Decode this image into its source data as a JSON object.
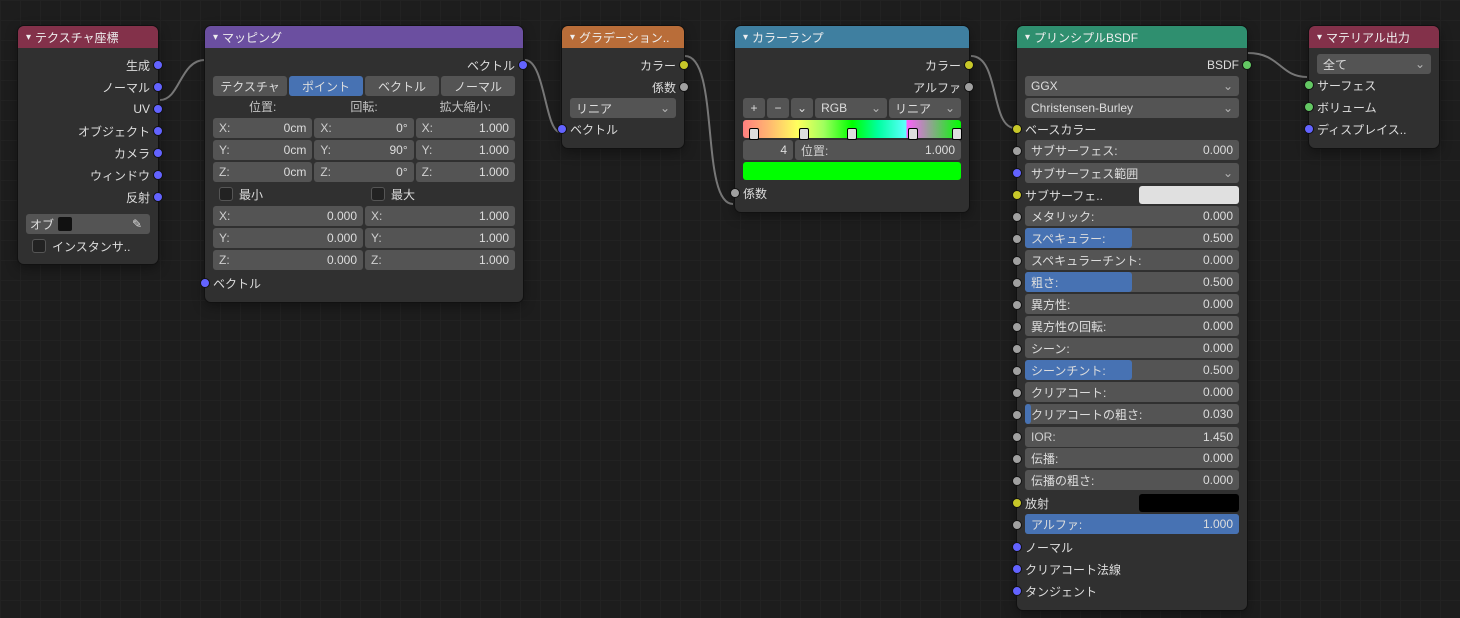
{
  "texcoord": {
    "title": "テクスチャ座標",
    "outs": [
      "生成",
      "ノーマル",
      "UV",
      "オブジェクト",
      "カメラ",
      "ウィンドウ",
      "反射"
    ],
    "obj_label": "オブ",
    "instancer": "インスタンサ.."
  },
  "mapping": {
    "title": "マッピング",
    "out": "ベクトル",
    "tabs": [
      "テクスチャ",
      "ポイント",
      "ベクトル",
      "ノーマル"
    ],
    "col_labels": [
      "位置:",
      "回転:",
      "拡大縮小:"
    ],
    "rows": [
      [
        "X:",
        "0cm",
        "X:",
        "0°",
        "X:",
        "1.000"
      ],
      [
        "Y:",
        "0cm",
        "Y:",
        "90°",
        "Y:",
        "1.000"
      ],
      [
        "Z:",
        "0cm",
        "Z:",
        "0°",
        "Z:",
        "1.000"
      ]
    ],
    "min": "最小",
    "max": "最大",
    "min_rows": [
      [
        "X:",
        "0.000"
      ],
      [
        "Y:",
        "0.000"
      ],
      [
        "Z:",
        "0.000"
      ]
    ],
    "max_rows": [
      [
        "X:",
        "1.000"
      ],
      [
        "Y:",
        "1.000"
      ],
      [
        "Z:",
        "1.000"
      ]
    ],
    "in": "ベクトル"
  },
  "gradient": {
    "title": "グラデーション..",
    "outs": [
      "カラー",
      "係数"
    ],
    "type": "リニア",
    "in": "ベクトル"
  },
  "colorramp": {
    "title": "カラーランプ",
    "outs": [
      "カラー",
      "アルファ"
    ],
    "toolbar": {
      "add": "+",
      "del": "−",
      "menu": "⌄",
      "mode": "RGB",
      "interp": "リニア"
    },
    "active": "4",
    "pos_label": "位置:",
    "pos": "1.000",
    "swatch": "#00ff00",
    "in": "係数"
  },
  "bsdf": {
    "title": "プリンシプルBSDF",
    "out": "BSDF",
    "dist": "GGX",
    "sss": "Christensen-Burley",
    "base": "ベースカラー",
    "sub": "サブサーフェス:",
    "sub_v": "0.000",
    "sub_r": "サブサーフェス範囲",
    "sub_c": "サブサーフェ..",
    "sub_c_color": "#e0e0e0",
    "metal": "メタリック:",
    "metal_v": "0.000",
    "spec": "スペキュラー:",
    "spec_v": "0.500",
    "spec_t": "スペキュラーチント:",
    "spec_t_v": "0.000",
    "rough": "粗さ:",
    "rough_v": "0.500",
    "aniso": "異方性:",
    "aniso_v": "0.000",
    "aniso_r": "異方性の回転:",
    "aniso_r_v": "0.000",
    "sheen": "シーン:",
    "sheen_v": "0.000",
    "sheen_t": "シーンチント:",
    "sheen_t_v": "0.500",
    "clear": "クリアコート:",
    "clear_v": "0.000",
    "clear_r": "クリアコートの粗さ:",
    "clear_r_v": "0.030",
    "ior": "IOR:",
    "ior_v": "1.450",
    "trans": "伝播:",
    "trans_v": "0.000",
    "trans_r": "伝播の粗さ:",
    "trans_r_v": "0.000",
    "emit": "放射",
    "emit_color": "#000000",
    "alpha": "アルファ:",
    "alpha_v": "1.000",
    "normal": "ノーマル",
    "cc_normal": "クリアコート法線",
    "tangent": "タンジェント"
  },
  "output": {
    "title": "マテリアル出力",
    "target": "全て",
    "surface": "サーフェス",
    "volume": "ボリューム",
    "disp": "ディスプレイス.."
  }
}
